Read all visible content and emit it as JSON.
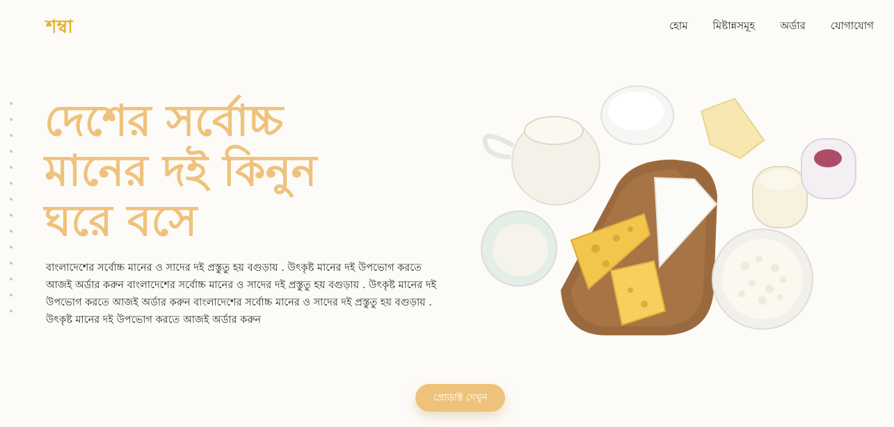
{
  "brand": {
    "logo_text": "শম্বা"
  },
  "nav": {
    "items": [
      {
        "label": "হোম"
      },
      {
        "label": "মিষ্টান্নসমূহ"
      },
      {
        "label": "অর্ডার"
      },
      {
        "label": "যোগাযোগ"
      }
    ]
  },
  "hero": {
    "headline_lines": [
      "দেশের সর্বোচ্চ",
      "মানের দই কিনুন",
      "ঘরে বসে"
    ],
    "description": "বাংলাদেশের সর্বোচ্চ মানের ও সাদের দই প্রস্তুতু হয় বগুড়ায় . উৎকৃষ্ট মানের দই উপভোগ করতে আজই অর্ডার করুন বাংলাদেশের সর্বোচ্চ মানের ও সাদের দই প্রস্তুতু হয় বগুড়ায় . উৎকৃষ্ট মানের দই উপভোগ করতে আজই অর্ডার করুন বাংলাদেশের সর্বোচ্চ মানের ও সাদের দই প্রস্তুতু হয় বগুড়ায় . উৎকৃষ্ট মানের দই উপভোগ করতে আজই অর্ডার করুন",
    "cta_label": "প্রোডাক্ট দেখুন"
  },
  "colors": {
    "accent": "#efc27c",
    "logo": "#e6b22c",
    "background": "#fdfbf8"
  }
}
